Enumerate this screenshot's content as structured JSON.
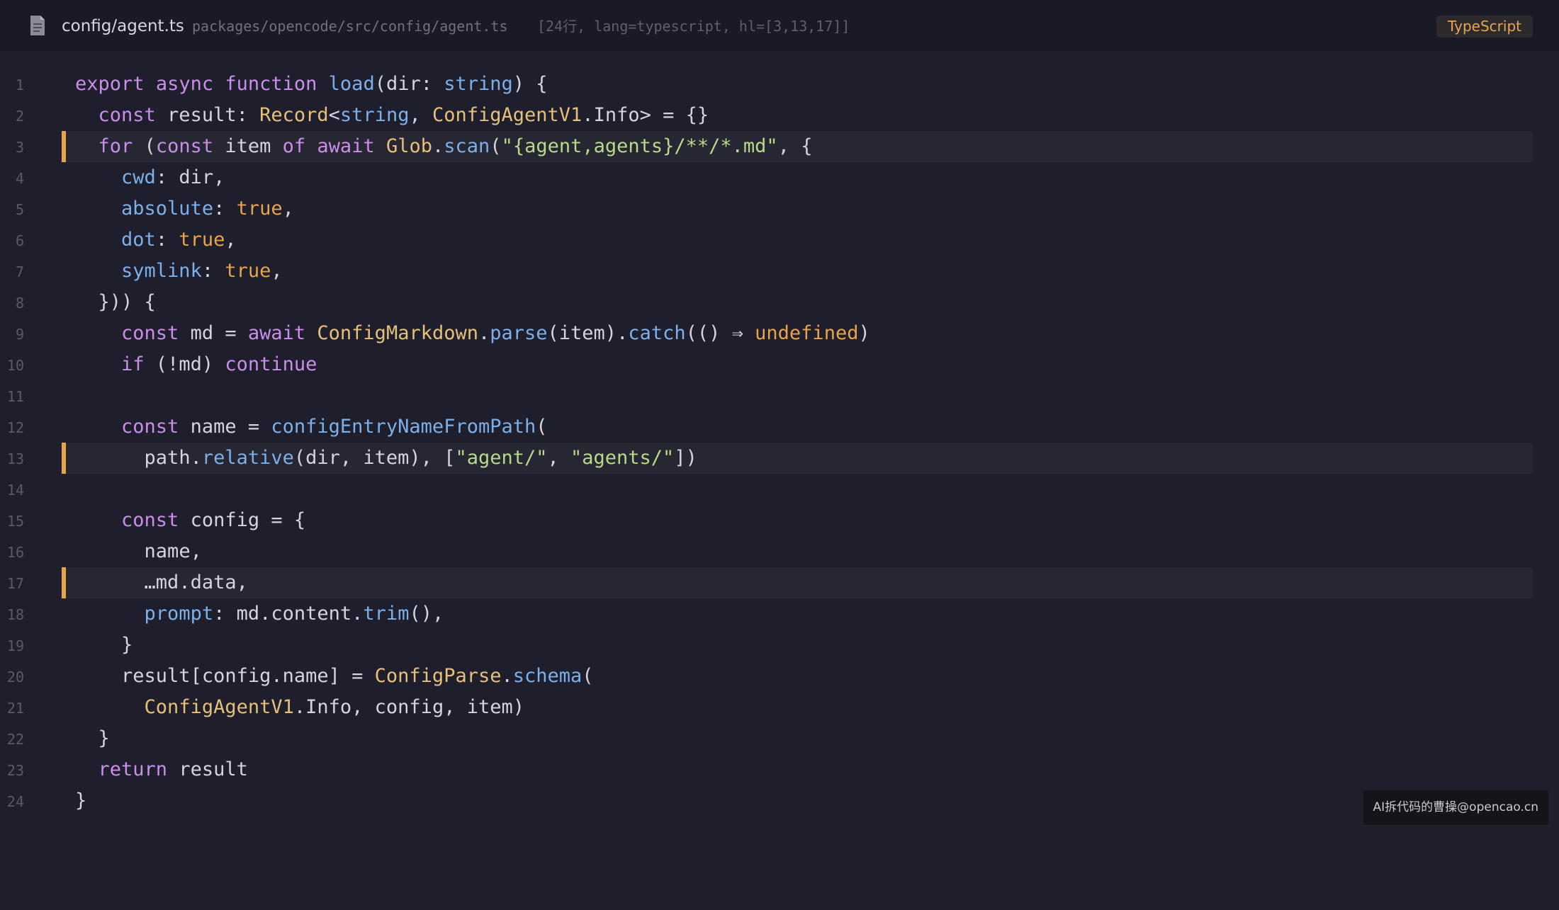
{
  "header": {
    "file_icon": "document-icon",
    "file_name": "config/agent.ts",
    "file_path": "packages/opencode/src/config/agent.ts",
    "file_meta": "[24行, lang=typescript, hl=[3,13,17]]",
    "language": "TypeScript"
  },
  "colors": {
    "background": "#1e1e2c",
    "header_background": "#1a1a26",
    "highlight_bar": "#e8a44d",
    "keyword": "#c98ee8",
    "function": "#7dafe8",
    "type": "#e5c07b",
    "string": "#b6d98a",
    "boolean": "#e8a44d"
  },
  "highlighted_lines": [
    3,
    13,
    17
  ],
  "code": {
    "lines": [
      {
        "n": "1"
      },
      {
        "n": "2"
      },
      {
        "n": "3"
      },
      {
        "n": "4"
      },
      {
        "n": "5"
      },
      {
        "n": "6"
      },
      {
        "n": "7"
      },
      {
        "n": "8"
      },
      {
        "n": "9"
      },
      {
        "n": "10"
      },
      {
        "n": "11"
      },
      {
        "n": "12"
      },
      {
        "n": "13"
      },
      {
        "n": "14"
      },
      {
        "n": "15"
      },
      {
        "n": "16"
      },
      {
        "n": "17"
      },
      {
        "n": "18"
      },
      {
        "n": "19"
      },
      {
        "n": "20"
      },
      {
        "n": "21"
      },
      {
        "n": "22"
      },
      {
        "n": "23"
      },
      {
        "n": "24"
      }
    ],
    "t": {
      "export": "export",
      "async": "async",
      "function": "function",
      "load": "load",
      "dir_param": "(dir: ",
      "string": "string",
      "open_paren_end": ") {",
      "const": "const",
      "result_colon": " result: ",
      "Record": "Record",
      "lt": "<",
      "comma_sp": ", ",
      "ConfigAgentV1": "ConfigAgentV1",
      "info_gt_eq": ".Info> = {}",
      "for": "for",
      "open_paren": " (",
      "item": " item ",
      "of": "of",
      "await": "await",
      "Glob": "Glob",
      "dot": ".",
      "scan": "scan",
      "paren": "(",
      "glob_str": "\"{agent,agents}/**/*.md\"",
      "comma_brace": ", {",
      "cwd": "cwd",
      "cwd_rest": ": dir,",
      "absolute": "absolute",
      "colon_sp": ": ",
      "true": "true",
      "comma": ",",
      "dot_key": "dot",
      "symlink": "symlink",
      "close_for": "})) {",
      "md_eq": " md = ",
      "ConfigMarkdown": "ConfigMarkdown",
      "parse": "parse",
      "item_paren": "(item).",
      "catch": "catch",
      "arrow": "(() ⇒ ",
      "undefined": "undefined",
      "close_paren": ")",
      "if": "if",
      "not_md": " (!md) ",
      "continue": "continue",
      "name_eq": " name = ",
      "configEntryNameFromPath": "configEntryNameFromPath",
      "path_dot": "path.",
      "relative": "relative",
      "dir_item": "(dir, item), [",
      "agent_str": "\"agent/\"",
      "agents_str": "\"agents/\"",
      "close_bracket_paren": "])",
      "config_eq": " config = {",
      "name_comma": "name,",
      "spread": "…md.data,",
      "prompt": "prompt",
      "content_dot": ": md.content.",
      "trim": "trim",
      "trim_end": "(),",
      "close_brace": "}",
      "result_index": "result[config.name] = ",
      "ConfigParse": "ConfigParse",
      "schema": "schema",
      "info_args": ".Info, config, item)",
      "return": "return",
      "result_word": " result"
    }
  },
  "watermark": "AI拆代码的曹操@opencao.cn"
}
